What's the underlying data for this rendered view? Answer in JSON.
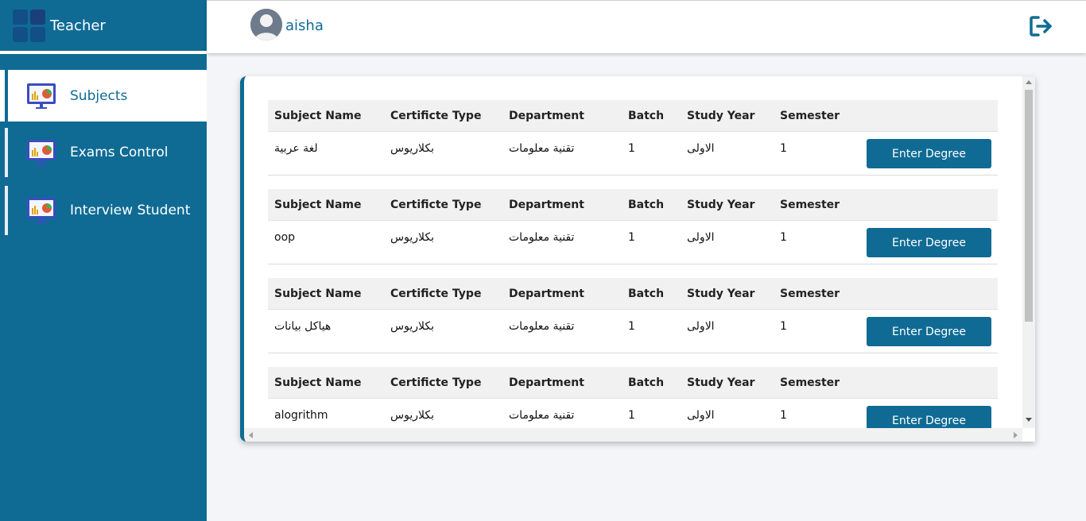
{
  "brand": {
    "title": "Teacher"
  },
  "sidebar": {
    "items": [
      {
        "label": "Subjects",
        "icon": "presentation-chart-icon",
        "active": true
      },
      {
        "label": "Exams Control",
        "icon": "presentation-chart-icon",
        "active": false
      },
      {
        "label": "Interview Student",
        "icon": "presentation-chart-icon",
        "active": false
      }
    ]
  },
  "topbar": {
    "username": "aisha",
    "logout_icon": "logout-icon"
  },
  "table": {
    "headers": [
      "Subject Name",
      "Certificte Type",
      "Department",
      "Batch",
      "Study Year",
      "Semester"
    ],
    "button_label": "Enter Degree",
    "rows": [
      {
        "subject": "لغة عربية",
        "certificate": "بكلاريوس",
        "department": "تقنية معلومات",
        "batch": "1",
        "year": "الاولى",
        "semester": "1"
      },
      {
        "subject": "oop",
        "certificate": "بكلاريوس",
        "department": "تقنية معلومات",
        "batch": "1",
        "year": "الاولى",
        "semester": "1"
      },
      {
        "subject": "هياكل بيانات",
        "certificate": "بكلاريوس",
        "department": "تقنية معلومات",
        "batch": "1",
        "year": "الاولى",
        "semester": "1"
      },
      {
        "subject": "alogrithm",
        "certificate": "بكلاريوس",
        "department": "تقنية معلومات",
        "batch": "1",
        "year": "الاولى",
        "semester": "1"
      }
    ]
  },
  "colors": {
    "primary": "#0f6b94",
    "background": "#f4f5f9",
    "header_row": "#f1f1f1"
  }
}
